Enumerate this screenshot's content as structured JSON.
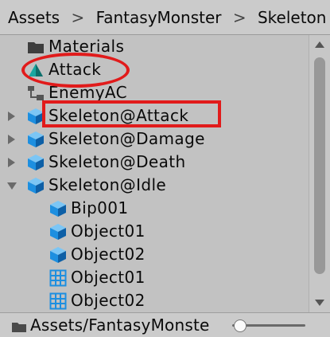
{
  "breadcrumb": [
    "Assets",
    "FantasyMonster",
    "Skeleton"
  ],
  "breadcrumb_separator": ">",
  "tree_items": [
    {
      "label": "Materials",
      "icon": "folder-icon",
      "expandable": false,
      "expanded": false
    },
    {
      "label": "Attack",
      "icon": "animation-clip-icon",
      "expandable": false,
      "expanded": false
    },
    {
      "label": "EnemyAC",
      "icon": "animator-controller-icon",
      "expandable": false,
      "expanded": false
    },
    {
      "label": "Skeleton@Attack",
      "icon": "model-prefab-icon",
      "expandable": true,
      "expanded": false
    },
    {
      "label": "Skeleton@Damage",
      "icon": "model-prefab-icon",
      "expandable": true,
      "expanded": false
    },
    {
      "label": "Skeleton@Death",
      "icon": "model-prefab-icon",
      "expandable": true,
      "expanded": false
    },
    {
      "label": "Skeleton@Idle",
      "icon": "model-prefab-icon",
      "expandable": true,
      "expanded": true
    },
    {
      "label": "Bip001",
      "icon": "model-prefab-icon",
      "expandable": false,
      "expanded": false
    },
    {
      "label": "Object01",
      "icon": "model-prefab-icon",
      "expandable": false,
      "expanded": false
    },
    {
      "label": "Object02",
      "icon": "model-prefab-icon",
      "expandable": false,
      "expanded": false
    },
    {
      "label": "Object01",
      "icon": "mesh-grid-icon",
      "expandable": false,
      "expanded": false
    },
    {
      "label": "Object02",
      "icon": "mesh-grid-icon",
      "expandable": false,
      "expanded": false
    }
  ],
  "status_bar": {
    "path": "Assets/FantasyMonste",
    "zoom_slider_value": 0.1
  },
  "colors": {
    "annotation_red": "#e11b1b",
    "prefab_blue": "#1d8fe0",
    "animation_teal": "#1aa6a0"
  }
}
